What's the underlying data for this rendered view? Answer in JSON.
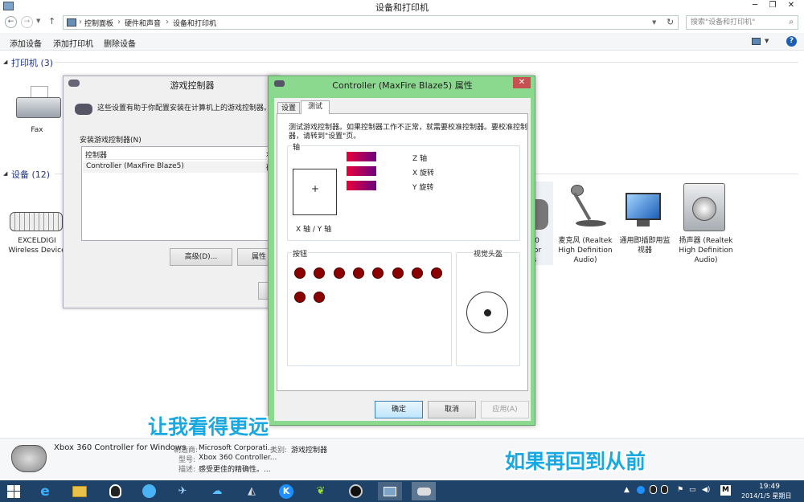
{
  "window": {
    "title": "设备和打印机"
  },
  "address": {
    "crumbs": [
      "控制面板",
      "硬件和声音",
      "设备和打印机"
    ],
    "sep": "›"
  },
  "search": {
    "placeholder": "搜索\"设备和打印机\""
  },
  "toolbar": {
    "add_device": "添加设备",
    "add_printer": "添加打印机",
    "remove_device": "删除设备"
  },
  "sections": {
    "printers": "打印机 (3)",
    "devices": "设备 (12)"
  },
  "devices": {
    "fax": "Fax",
    "keyboard": [
      "EXCELDIGI",
      "Wireless Device"
    ],
    "mic": [
      "麦克风 (Realtek",
      "High Definition",
      "Audio)"
    ],
    "monitor": [
      "通用即插即用监",
      "视器"
    ],
    "speaker": [
      "扬声器 (Realtek",
      "High Definition",
      "Audio)"
    ],
    "partial": [
      "0",
      "for",
      "s"
    ]
  },
  "game_dialog": {
    "title": "游戏控制器",
    "desc": "这些设置有助于你配置安装在计算机上的游戏控制器。",
    "installed_label": "安装游戏控制器(N)",
    "col_controller": "控制器",
    "col_status": "状",
    "row_name": "Controller (MaxFire Blaze5)",
    "row_status": "确",
    "advanced": "高级(D)...",
    "props": "属性"
  },
  "prop_dialog": {
    "title": "Controller (MaxFire Blaze5) 属性",
    "close": "✕",
    "tabs": [
      "设置",
      "测试"
    ],
    "info": [
      "测试游戏控制器。如果控制器工作不正常，就需要校准控制器。要校准控制",
      "器，请转到\"设置\"页。"
    ],
    "axes_group": "轴",
    "axes": [
      "Z 轴",
      "X 旋转",
      "Y 旋转"
    ],
    "xy_label": "X 轴 / Y 轴",
    "buttons_group": "按钮",
    "pov_group": "视觉头盔",
    "ok": "确定",
    "cancel": "取消",
    "apply": "应用(A)",
    "button_count": 10
  },
  "details": {
    "name": "Xbox 360 Controller for Windows",
    "mfr_label": "制造商:",
    "mfr": "Microsoft Corporati...",
    "cat_label": "类别:",
    "cat": "游戏控制器",
    "model_label": "型号:",
    "model": "Xbox 360 Controller...",
    "desc_label": "描述:",
    "desc": "感受更佳的精确性。..."
  },
  "captions": {
    "left": "让我看得更远",
    "right": "如果再回到从前"
  },
  "tray": {
    "time": "19:49",
    "date": "2014/1/5 星期日",
    "ime": "M"
  },
  "colors": {
    "accent": "#1e3287",
    "dialog_frame": "#8bd88f",
    "taskbar": "#1f4268",
    "caption": "#1aa8e0"
  }
}
